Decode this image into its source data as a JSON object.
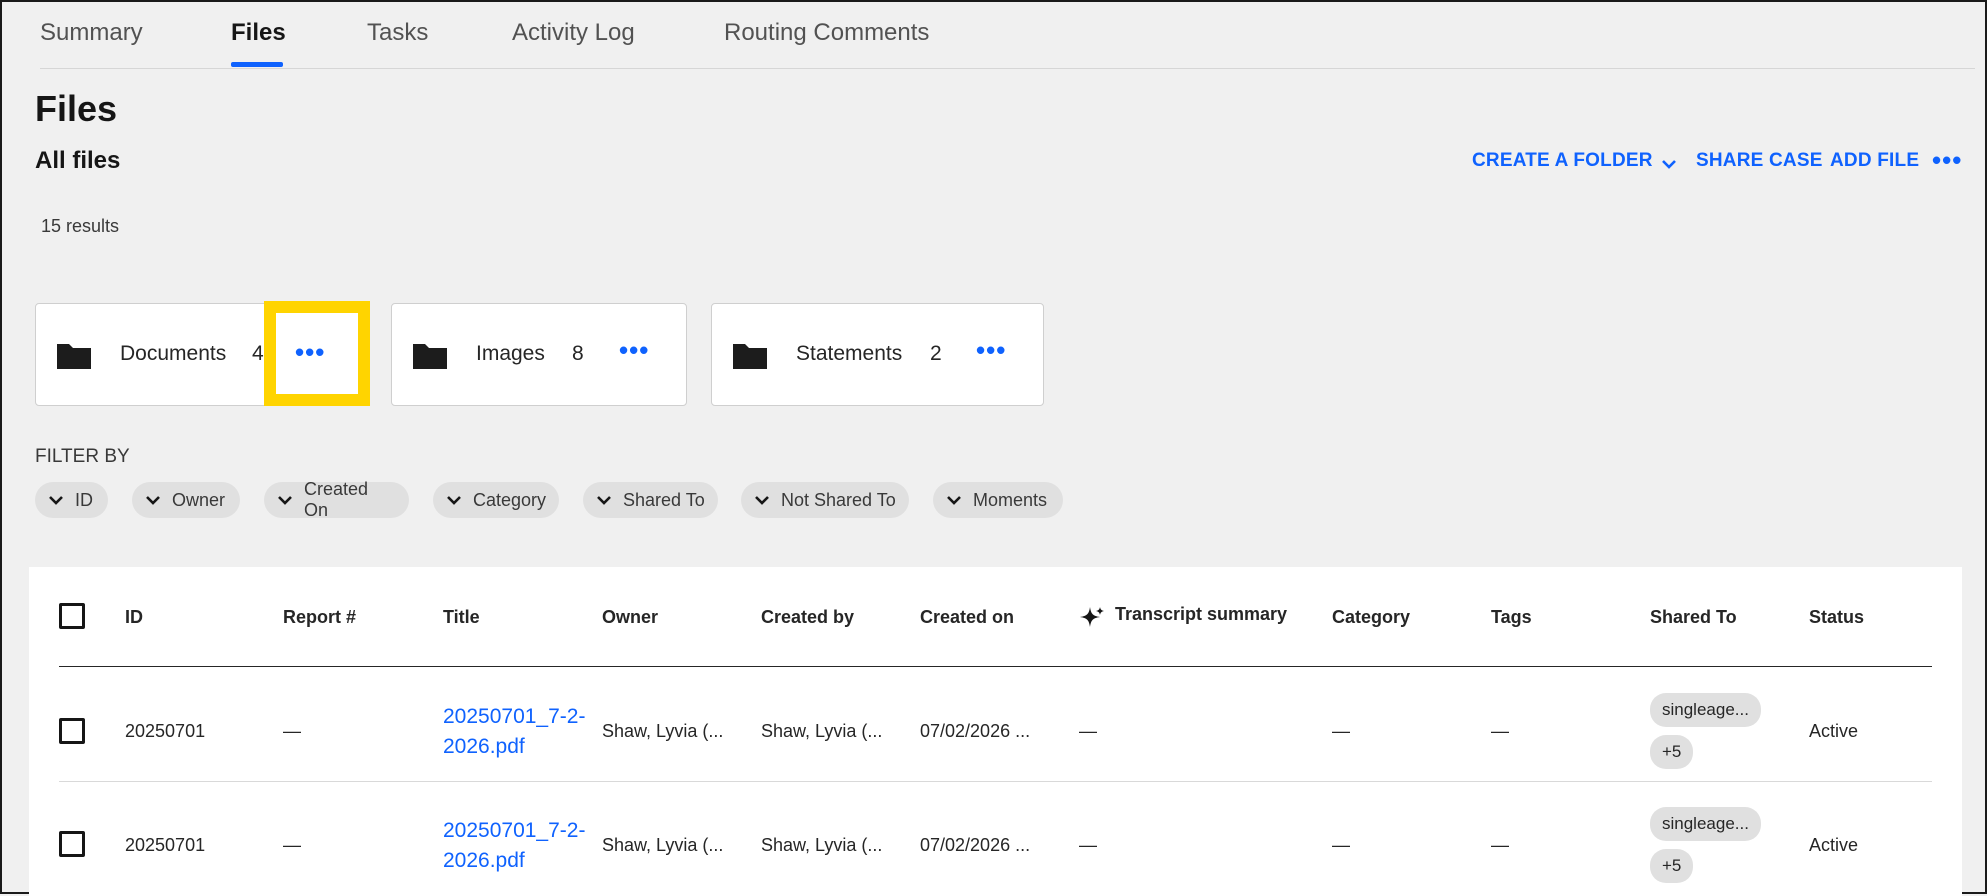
{
  "tabs": [
    "Summary",
    "Files",
    "Tasks",
    "Activity Log",
    "Routing Comments"
  ],
  "active_tab": "Files",
  "page_title": "Files",
  "subtitle": "All files",
  "actions": {
    "create_folder": "CREATE A FOLDER",
    "share_case": "SHARE CASE",
    "add_file": "ADD FILE"
  },
  "results": "15 results",
  "folders": [
    {
      "name": "Documents",
      "count": "4"
    },
    {
      "name": "Images",
      "count": "8"
    },
    {
      "name": "Statements",
      "count": "2"
    }
  ],
  "filter_label": "FILTER BY",
  "filters": [
    "ID",
    "Owner",
    "Created On",
    "Category",
    "Shared To",
    "Not Shared To",
    "Moments"
  ],
  "table": {
    "headers": [
      "ID",
      "Report #",
      "Title",
      "Owner",
      "Created by",
      "Created on",
      "Transcript summary",
      "Category",
      "Tags",
      "Shared To",
      "Status"
    ],
    "rows": [
      {
        "id": "20250701",
        "report": "—",
        "title": "20250701_7-2-2026.pdf",
        "owner": "Shaw, Lyvia (...",
        "created_by": "Shaw, Lyvia (...",
        "created_on": "07/02/2026 ...",
        "summary": "—",
        "category": "—",
        "tags": "—",
        "shared_to": "singleage...",
        "shared_more": "+5",
        "status": "Active"
      },
      {
        "id": "20250701",
        "report": "—",
        "title": "20250701_7-2-2026.pdf",
        "owner": "Shaw, Lyvia (...",
        "created_by": "Shaw, Lyvia (...",
        "created_on": "07/02/2026 ...",
        "summary": "—",
        "category": "—",
        "tags": "—",
        "shared_to": "singleage...",
        "shared_more": "+5",
        "status": "Active"
      }
    ]
  },
  "colors": {
    "accent": "#0f62fe",
    "highlight": "#ffd400",
    "background": "#f0f0f0"
  },
  "icons": [
    "folder-icon",
    "overflow-menu-icon",
    "chevron-down-icon",
    "sparkle-icon",
    "checkbox-icon"
  ]
}
